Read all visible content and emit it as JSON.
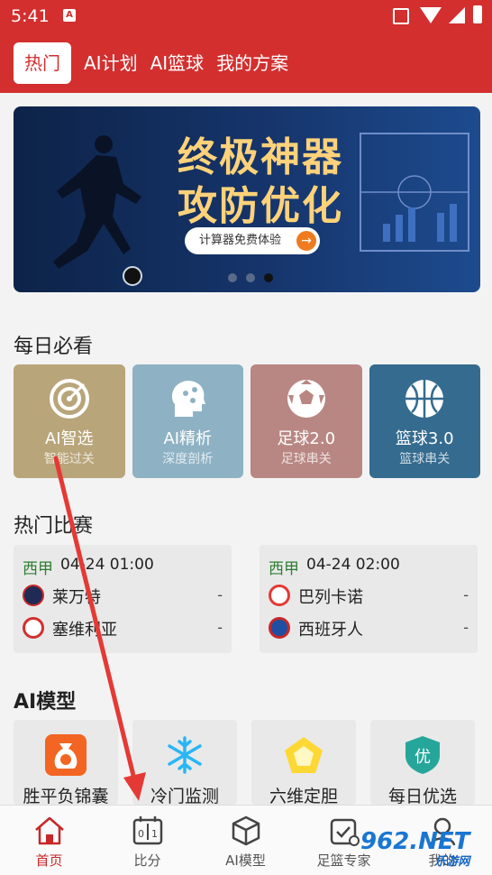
{
  "status": {
    "time": "5:41",
    "badge": "A"
  },
  "tabs": [
    {
      "label": "热门"
    },
    {
      "label": "AI计划"
    },
    {
      "label": "AI篮球"
    },
    {
      "label": "我的方案"
    }
  ],
  "banner": {
    "line1": "终极神器",
    "line2": "攻防优化",
    "cta": "计算器免费体验",
    "pages": 3,
    "active_page": 3
  },
  "daily": {
    "title": "每日必看",
    "items": [
      {
        "name": "AI智选",
        "sub": "智能过关",
        "color": "#b9a57a",
        "icon": "target-icon"
      },
      {
        "name": "AI精析",
        "sub": "深度剖析",
        "color": "#8eb2c4",
        "icon": "brain-head-icon"
      },
      {
        "name": "足球2.0",
        "sub": "足球串关",
        "color": "#b98783",
        "icon": "soccer-ball-icon"
      },
      {
        "name": "篮球3.0",
        "sub": "篮球串关",
        "color": "#356b8f",
        "icon": "basketball-icon"
      }
    ]
  },
  "hot": {
    "title": "热门比赛",
    "matches": [
      {
        "league": "西甲",
        "time": "04-24 01:00",
        "home": {
          "name": "莱万特",
          "score": "-"
        },
        "away": {
          "name": "塞维利亚",
          "score": "-"
        }
      },
      {
        "league": "西甲",
        "time": "04-24 02:00",
        "home": {
          "name": "巴列卡诺",
          "score": "-"
        },
        "away": {
          "name": "西班牙人",
          "score": "-"
        }
      }
    ]
  },
  "models": {
    "title": "AI模型",
    "items": [
      {
        "name": "胜平负锦囊",
        "icon": "money-bag-icon"
      },
      {
        "name": "冷门监测",
        "icon": "snowflake-icon"
      },
      {
        "name": "六维定胆",
        "icon": "pentagon-icon"
      },
      {
        "name": "每日优选",
        "icon": "shield-badge-icon"
      }
    ]
  },
  "nav": [
    {
      "label": "首页",
      "icon": "home-icon"
    },
    {
      "label": "比分",
      "icon": "scoreboard-icon"
    },
    {
      "label": "AI模型",
      "icon": "cube-icon"
    },
    {
      "label": "足篮专家",
      "icon": "expert-calendar-icon"
    },
    {
      "label": "我的",
      "icon": "user-icon"
    }
  ],
  "watermark": {
    "text": "962.NET",
    "sub": "乐游网"
  },
  "colors": {
    "brand": "#d32f2f",
    "league": "#2e7d32",
    "arrow": "#e53935"
  }
}
